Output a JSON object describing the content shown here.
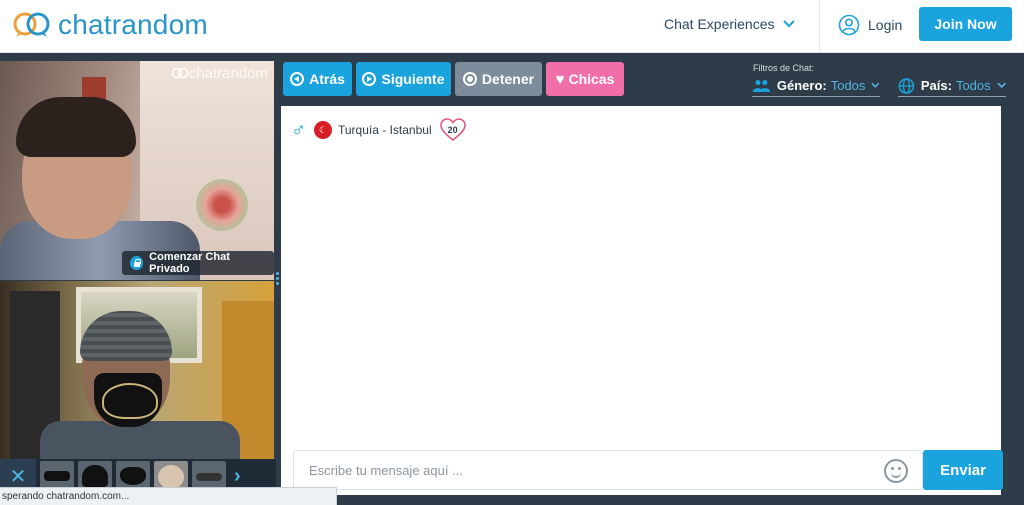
{
  "header": {
    "logo_text": "chatrandom",
    "nav_experiences": "Chat Experiences",
    "login": "Login",
    "join": "Join Now"
  },
  "left_panel": {
    "watermark": "chatrandom",
    "private_chat_label": "Comenzar Chat Privado",
    "status_text": "sperando chatrandom.com..."
  },
  "toolbar": {
    "back": "Atrás",
    "next": "Siguiente",
    "stop": "Detener",
    "girls": "Chicas"
  },
  "filters": {
    "title": "Filtros de Chat:",
    "gender_label": "Género:",
    "gender_value": "Todos",
    "country_label": "País:",
    "country_value": "Todos"
  },
  "partner": {
    "location": "Turquía - Istanbul",
    "age": "20"
  },
  "composer": {
    "placeholder": "Escribe tu mensaje aquí ...",
    "send": "Enviar"
  },
  "colors": {
    "brand_blue": "#1aa3dc",
    "panel_dark": "#2e3b48",
    "stop_gray": "#7d8d9c",
    "girls_pink": "#f06fa8"
  },
  "icons": [
    "chat-bubbles-icon",
    "chevron-down-icon",
    "user-circle-icon",
    "lock-icon",
    "close-icon",
    "chevron-right-icon",
    "back-icon",
    "next-icon",
    "stop-icon",
    "heart-icon",
    "users-icon",
    "globe-icon",
    "male-icon",
    "turkey-flag-icon",
    "heart-outline-icon",
    "smiley-icon"
  ]
}
